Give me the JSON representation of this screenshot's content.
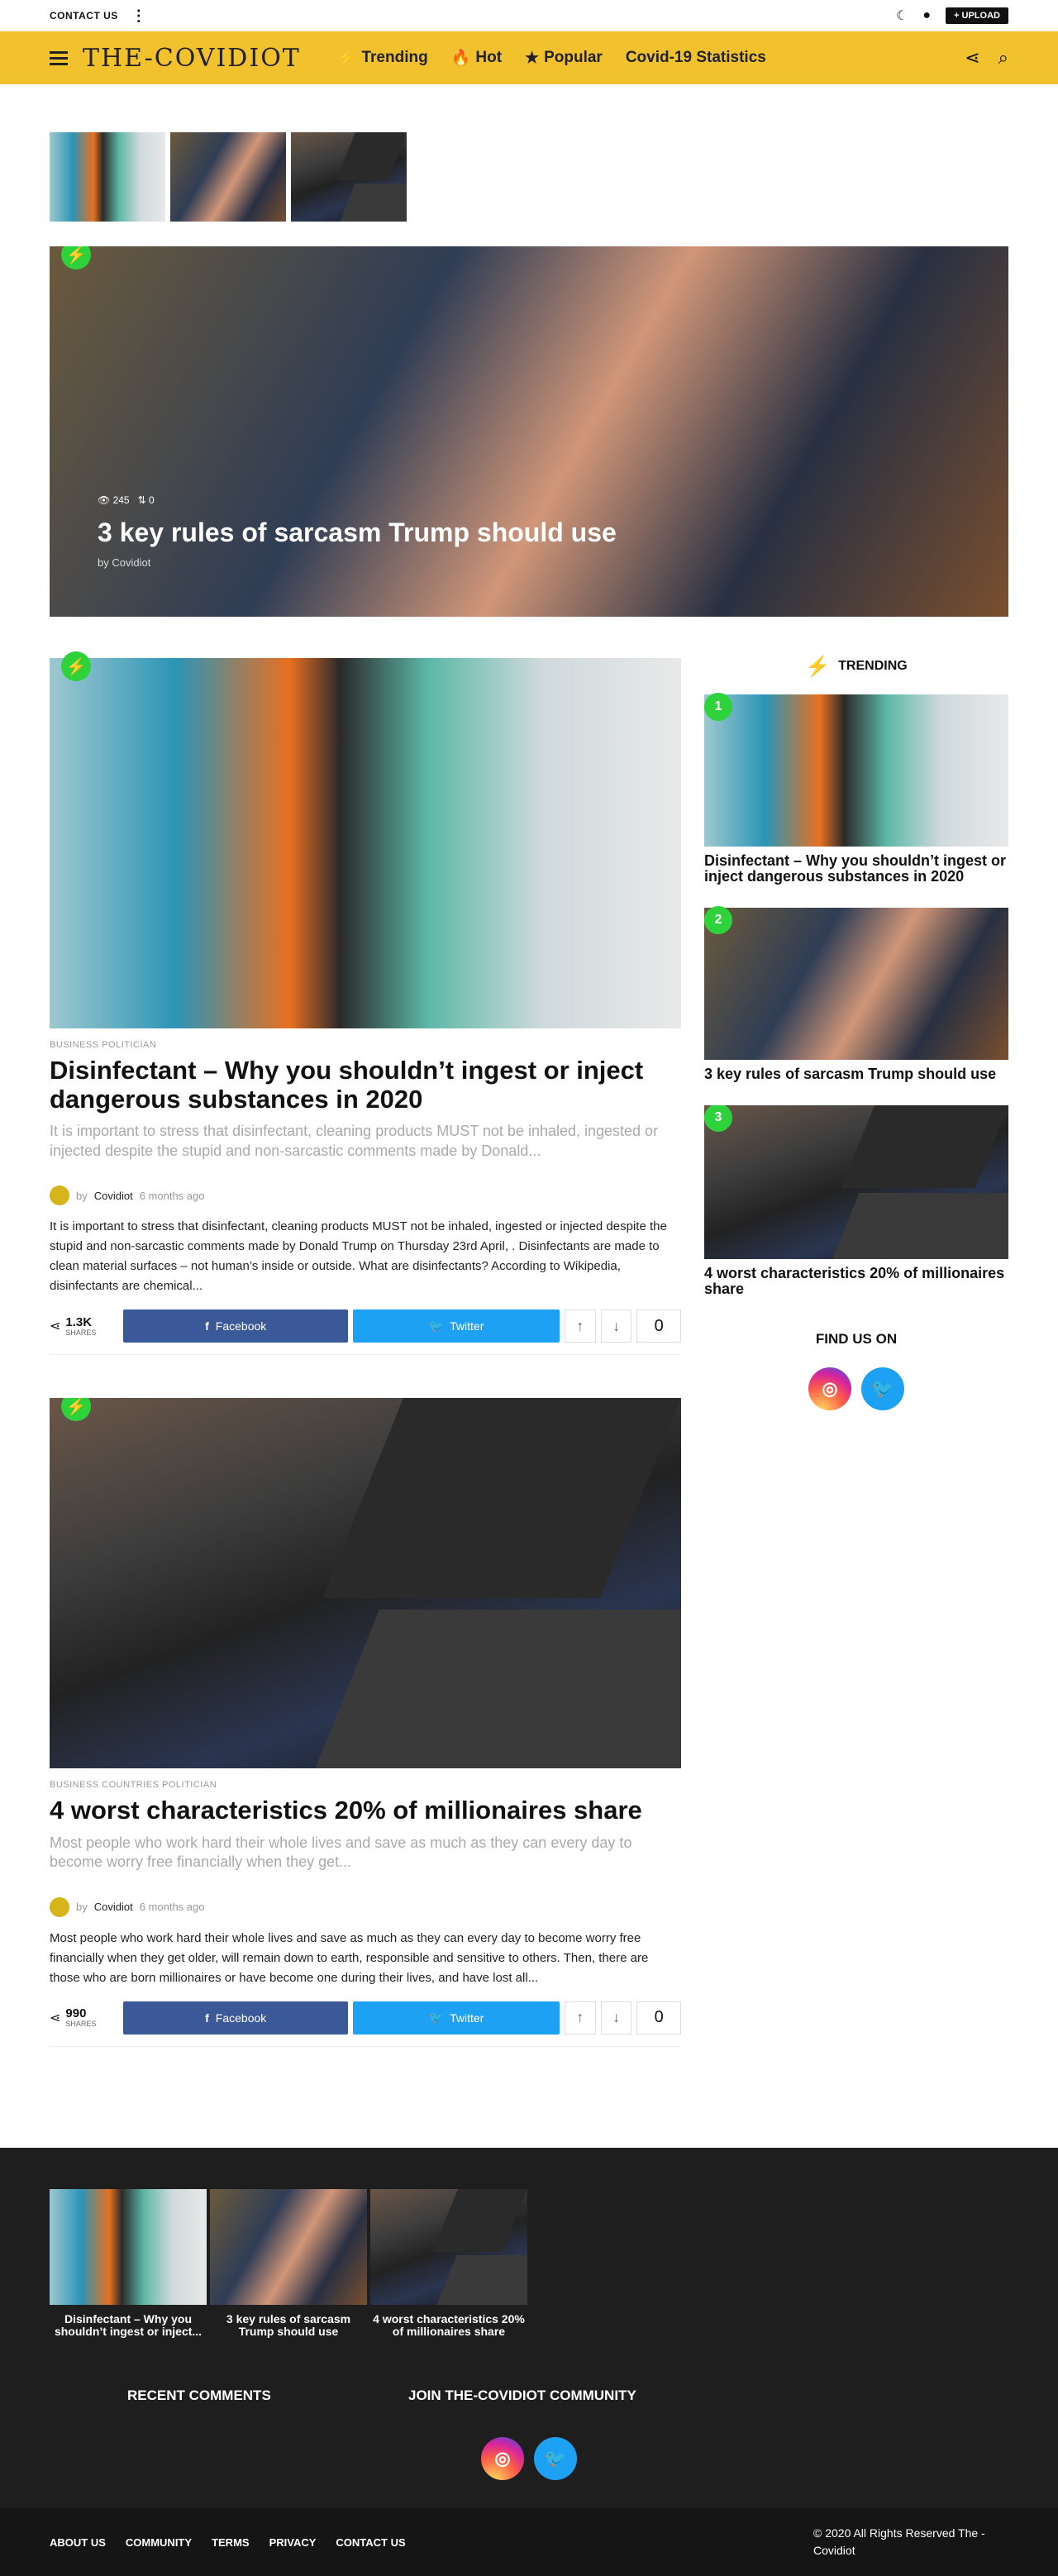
{
  "topbar": {
    "contact": "CONTACT US",
    "upload": "UPLOAD"
  },
  "nav": {
    "logo": "THE-COVIDIOT",
    "items": [
      "Trending",
      "Hot",
      "Popular",
      "Covid-19 Statistics"
    ]
  },
  "hero": {
    "views": "245",
    "shares": "0",
    "title": "3 key rules of sarcasm Trump should use",
    "by": "by",
    "author": "Covidiot"
  },
  "posts": [
    {
      "categories": "BUSINESS  POLITICIAN",
      "title": "Disinfectant – Why you shouldn’t ingest or inject dangerous substances in 2020",
      "excerpt": "It is important to stress that disinfectant, cleaning products MUST not be inhaled, ingested or injected despite the stupid and non-sarcastic comments made by Donald...",
      "by": "by",
      "author": "Covidiot",
      "time": "6 months ago",
      "body": "It is important to stress that disinfectant, cleaning products MUST not be inhaled, ingested or injected despite the stupid and non-sarcastic comments made by Donald Trump on Thursday 23rd April, . Disinfectants are made to clean material surfaces – not human’s inside or outside.   What are disinfectants?   According to Wikipedia, disinfectants are chemical...",
      "share_count": "1.3K",
      "share_label": "SHARES",
      "facebook": "Facebook",
      "twitter": "Twitter",
      "votes": "0"
    },
    {
      "categories": "BUSINESS  COUNTRIES  POLITICIAN",
      "title": "4 worst characteristics 20% of millionaires share",
      "excerpt": "Most people who work hard their whole lives and save as much as they can every day to become worry free financially when they get...",
      "by": "by",
      "author": "Covidiot",
      "time": "6 months ago",
      "body": "Most people who work hard their whole lives and save as much as they can every day to become worry free financially when they get older, will remain down to earth, responsible and sensitive to others. Then, there are those who are born millionaires or have become one during their lives, and have lost all...",
      "share_count": "990",
      "share_label": "SHARES",
      "facebook": "Facebook",
      "twitter": "Twitter",
      "votes": "0"
    }
  ],
  "sidebar": {
    "heading": "TRENDING",
    "items": [
      {
        "num": "1",
        "title": "Disinfectant – Why you shouldn’t ingest or inject dangerous substances in 2020"
      },
      {
        "num": "2",
        "title": "3 key rules of sarcasm Trump should use"
      },
      {
        "num": "3",
        "title": "4 worst characteristics 20% of millionaires share"
      }
    ],
    "find_us": "FIND US ON"
  },
  "footer": {
    "thumbs": [
      "Disinfectant – Why you shouldn’t ingest or inject...",
      "3 key rules of sarcasm Trump should use",
      "4 worst characteristics 20% of millionaires share"
    ],
    "recent_comments": "RECENT COMMENTS",
    "join": "JOIN THE-COVIDIOT COMMUNITY",
    "links": [
      "ABOUT US",
      "COMMUNITY",
      "TERMS",
      "PRIVACY",
      "CONTACT US"
    ],
    "copyright": "© 2020 All Rights Reserved The - Covidiot"
  },
  "colors": {
    "accent": "#f2c12e",
    "badge": "#2ed23a",
    "facebook": "#3b5998",
    "twitter": "#1da1f2"
  }
}
